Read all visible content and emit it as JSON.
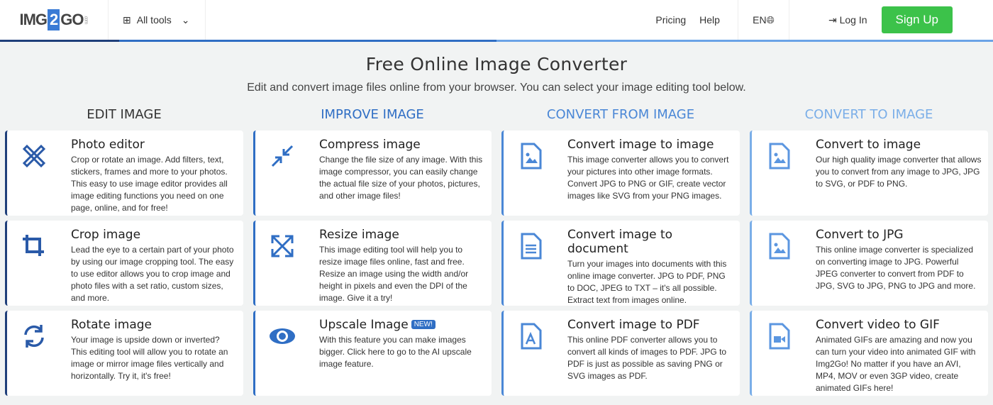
{
  "nav": {
    "logo": "IMG2GO",
    "logo_left": "IMG",
    "logo_mid": "2",
    "logo_right": "GO",
    "logo_suffix": ".com",
    "all_tools": "All tools",
    "pricing": "Pricing",
    "help": "Help",
    "lang": "EN",
    "login": "Log In",
    "signup": "Sign Up"
  },
  "hero": {
    "title": "Free Online Image Converter",
    "subtitle": "Edit and convert image files online from your browser. You can select your image editing tool below."
  },
  "colors": {
    "edit": "#1f3f7a",
    "improve": "#2f6ec4",
    "from": "#4a87d6",
    "to": "#7aaee8",
    "signup": "#3cc24a"
  },
  "columns": [
    {
      "heading": "EDIT IMAGE",
      "cards": [
        {
          "title": "Photo editor",
          "icon": "pencil-ruler-icon",
          "desc": "Crop or rotate an image. Add filters, text, stickers, frames and more to your photos. This easy to use image editor provides all image editing functions you need on one page, online, and for free!"
        },
        {
          "title": "Crop image",
          "icon": "crop-icon",
          "desc": "Lead the eye to a certain part of your photo by using our image cropping tool. The easy to use editor allows you to crop image and photo files with a set ratio, custom sizes, and more."
        },
        {
          "title": "Rotate image",
          "icon": "rotate-icon",
          "desc": "Your image is upside down or inverted? This editing tool will allow you to rotate an image or mirror image files vertically and horizontally. Try it, it's free!"
        }
      ]
    },
    {
      "heading": "IMPROVE IMAGE",
      "cards": [
        {
          "title": "Compress image",
          "icon": "compress-icon",
          "desc": "Change the file size of any image. With this image compressor, you can easily change the actual file size of your photos, pictures, and other image files!"
        },
        {
          "title": "Resize image",
          "icon": "expand-icon",
          "desc": "This image editing tool will help you to resize image files online, fast and free. Resize an image using the width and/or height in pixels and even the DPI of the image. Give it a try!"
        },
        {
          "title": "Upscale Image",
          "badge": "NEW!",
          "icon": "eye-icon",
          "desc": "With this feature you can make images bigger. Click here to go to the AI upscale image feature."
        }
      ]
    },
    {
      "heading": "CONVERT FROM IMAGE",
      "cards": [
        {
          "title": "Convert image to image",
          "icon": "image-file-icon",
          "desc": "This image converter allows you to convert your pictures into other image formats. Convert JPG to PNG or GIF, create vector images like SVG from your PNG images."
        },
        {
          "title": "Convert image to document",
          "icon": "document-icon",
          "desc": "Turn your images into documents with this online image converter. JPG to PDF, PNG to DOC, JPEG to TXT – it's all possible. Extract text from images online."
        },
        {
          "title": "Convert image to PDF",
          "icon": "pdf-file-icon",
          "desc": "This online PDF converter allows you to convert all kinds of images to PDF. JPG to PDF is just as possible as saving PNG or SVG images as PDF."
        }
      ]
    },
    {
      "heading": "CONVERT TO IMAGE",
      "cards": [
        {
          "title": "Convert to image",
          "icon": "image-file-icon",
          "desc": "Our high quality image converter that allows you to convert from any image to JPG, JPG to SVG, or PDF to PNG."
        },
        {
          "title": "Convert to JPG",
          "icon": "image-file-icon",
          "desc": "This online image converter is specialized on converting image to JPG. Powerful JPEG converter to convert from PDF to JPG, SVG to JPG, PNG to JPG and more."
        },
        {
          "title": "Convert video to GIF",
          "icon": "video-file-icon",
          "desc": "Animated GIFs are amazing and now you can turn your video into animated GIF with Img2Go! No matter if you have an AVI, MP4, MOV or even 3GP video, create animated GIFs here!"
        }
      ]
    }
  ]
}
